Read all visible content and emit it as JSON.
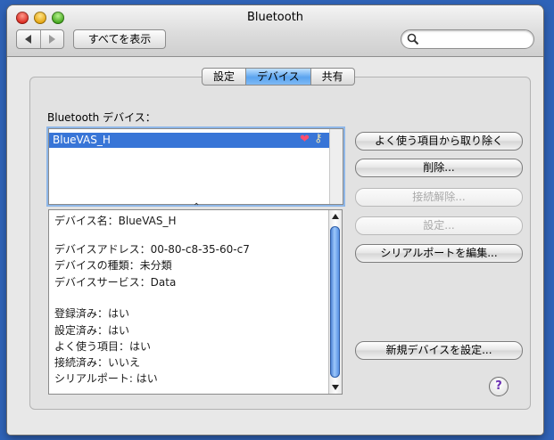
{
  "window": {
    "title": "Bluetooth"
  },
  "toolbar": {
    "show_all": "すべてを表示",
    "search_placeholder": ""
  },
  "tabs": [
    {
      "label": "設定"
    },
    {
      "label": "デバイス"
    },
    {
      "label": "共有"
    }
  ],
  "devices": {
    "section_label": "Bluetooth デバイス：",
    "items": [
      {
        "name": "BlueVAS_H"
      }
    ]
  },
  "info": {
    "lines": [
      "デバイス名：BlueVAS_H",
      "デバイスアドレス：00-80-c8-35-60-c7",
      "デバイスの種類：未分類",
      "デバイスサービス：Data",
      "登録済み：はい",
      "設定済み：はい",
      "よく使う項目：はい",
      "接続済み：いいえ",
      "シリアルポート: はい"
    ]
  },
  "buttons": {
    "remove_favorite": "よく使う項目から取り除く",
    "delete": "削除...",
    "disconnect": "接続解除...",
    "configure": "設定...",
    "edit_serial": "シリアルポートを編集...",
    "setup_new": "新規デバイスを設定..."
  },
  "colors": {
    "selection": "#3875d7",
    "accent": "#5aa4ef"
  }
}
